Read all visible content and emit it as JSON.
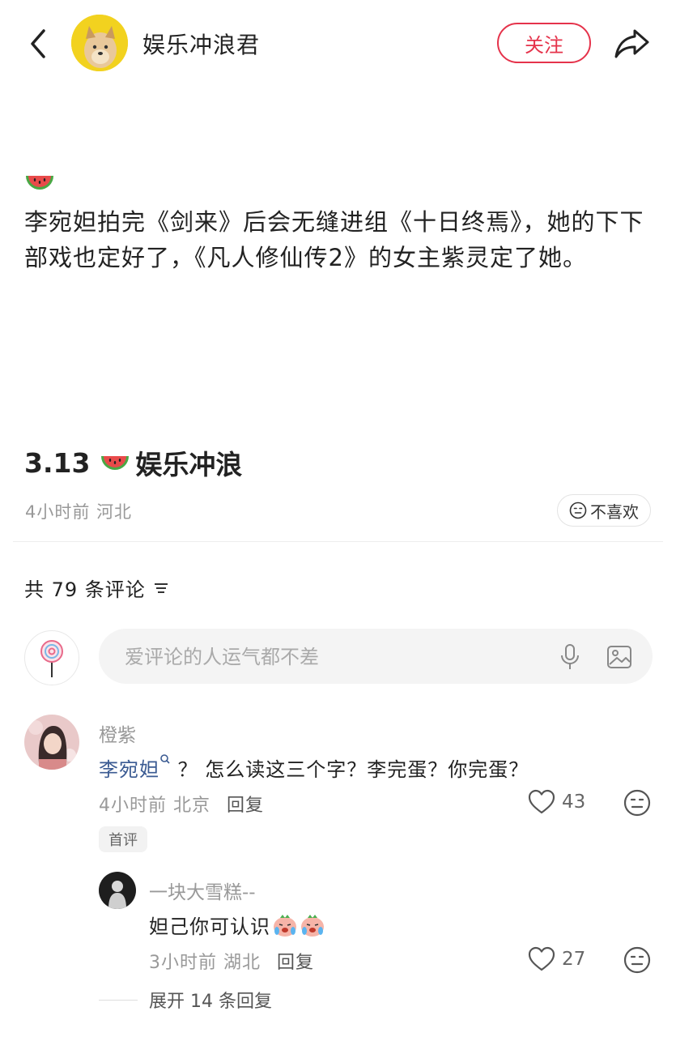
{
  "header": {
    "author_name": "娱乐冲浪君",
    "follow_label": "关注",
    "back_icon": "chevron-left-icon",
    "share_icon": "share-arrow-icon",
    "accent_color": "#e5334b"
  },
  "post": {
    "lead_emoji": "watermelon",
    "text": "李宛妲拍完《剑来》后会无缝进组《十日终焉》，她的下下部戏也定好了，《凡人修仙传2》的女主紫灵定了她。",
    "title_date": "3.13",
    "title_suffix": "娱乐冲浪",
    "time": "4小时前",
    "location": "河北",
    "dislike_label": "不喜欢"
  },
  "comments_section": {
    "count_label": "共 79 条评论",
    "input_placeholder": "爱评论的人运气都不差"
  },
  "comments": [
    {
      "user": "橙紫",
      "mention": "李宛妲",
      "text": "？ 怎么读这三个字？李完蛋？你完蛋？",
      "time": "4小时前",
      "location": "北京",
      "reply_label": "回复",
      "likes": "43",
      "badge": "首评"
    }
  ],
  "replies": [
    {
      "user": "一块大雪糕--",
      "text": "妲己你可认识",
      "time": "3小时前",
      "location": "湖北",
      "reply_label": "回复",
      "likes": "27"
    }
  ],
  "expand_label": "展开 14 条回复"
}
